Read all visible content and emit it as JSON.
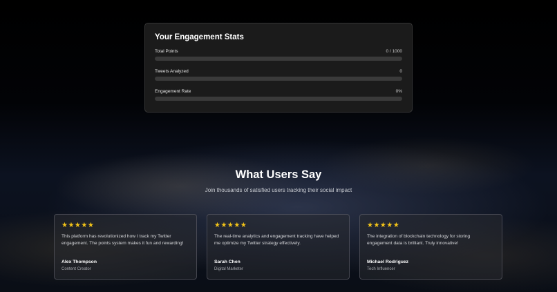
{
  "stats": {
    "title": "Your Engagement Stats",
    "rows": [
      {
        "label": "Total Points",
        "value": "0 / 1000",
        "progress": 0
      },
      {
        "label": "Tweets Analyzed",
        "value": "0",
        "progress": 0
      },
      {
        "label": "Engagement Rate",
        "value": "0%",
        "progress": 0
      }
    ]
  },
  "testimonials": {
    "title": "What Users Say",
    "subtitle": "Join thousands of satisfied users tracking their social impact",
    "items": [
      {
        "stars": "★★★★★",
        "text": "This platform has revolutionized how I track my Twitter engagement. The points system makes it fun and rewarding!",
        "name": "Alex Thompson",
        "role": "Content Creator"
      },
      {
        "stars": "★★★★★",
        "text": "The real-time analytics and engagement tracking have helped me optimize my Twitter strategy effectively.",
        "name": "Sarah Chen",
        "role": "Digital Marketer"
      },
      {
        "stars": "★★★★★",
        "text": "The integration of blockchain technology for storing engagement data is brilliant. Truly innovative!",
        "name": "Michael Rodriguez",
        "role": "Tech Influencer"
      }
    ]
  },
  "colors": {
    "star": "#f5c518",
    "card_bg": "#1b1b1b",
    "bar_track": "#3a3a3a"
  }
}
